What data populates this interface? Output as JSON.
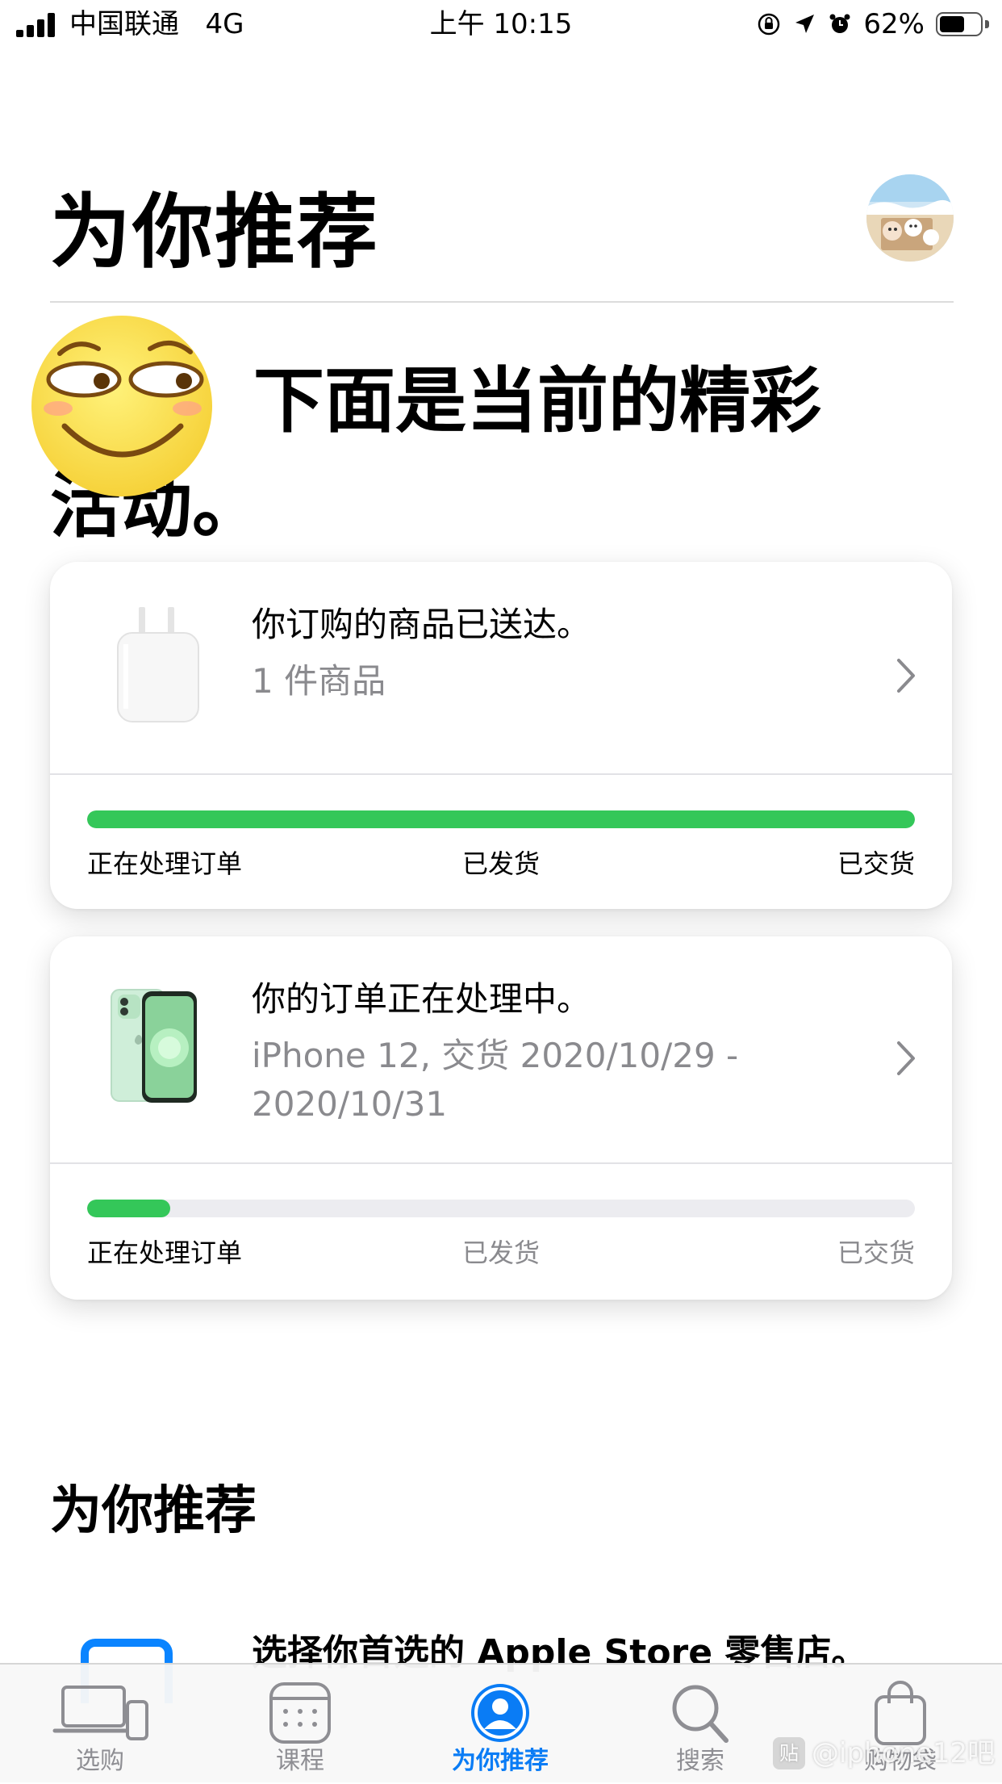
{
  "status_bar": {
    "carrier": "中国联通",
    "network": "4G",
    "time": "上午 10:15",
    "battery_percent": "62%",
    "battery_level": 0.62,
    "icons": [
      "signal-icon",
      "orientation-lock-icon",
      "location-icon",
      "alarm-icon",
      "battery-icon"
    ]
  },
  "header": {
    "title": "为你推荐"
  },
  "headline": {
    "line1": "下面是当前的精彩",
    "line2": "活动。"
  },
  "orders": [
    {
      "title": "你订购的商品已送达。",
      "subtitle": "1 件商品",
      "product_icon": "charger-icon",
      "progress": 1.0,
      "stages": [
        "正在处理订单",
        "已发货",
        "已交货"
      ],
      "stages_done": [
        true,
        true,
        true
      ]
    },
    {
      "title": "你的订单正在处理中。",
      "subtitle": "iPhone 12, 交货 2020/10/29 - 2020/10/31",
      "product_icon": "iphone-icon",
      "progress": 0.1,
      "stages": [
        "正在处理订单",
        "已发货",
        "已交货"
      ],
      "stages_done": [
        true,
        false,
        false
      ]
    }
  ],
  "recommend": {
    "section_title": "为你推荐",
    "item_text": "选择你首选的 Apple Store 零售店。"
  },
  "tabbar": {
    "tabs": [
      {
        "label": "选购",
        "icon": "devices-icon",
        "active": false
      },
      {
        "label": "课程",
        "icon": "calendar-icon",
        "active": false
      },
      {
        "label": "为你推荐",
        "icon": "person-icon",
        "active": true
      },
      {
        "label": "搜索",
        "icon": "search-icon",
        "active": false
      },
      {
        "label": "购物袋",
        "icon": "bag-icon",
        "active": false
      }
    ]
  },
  "watermark": "@iphone12吧",
  "colors": {
    "progress_green": "#34c759",
    "active_blue": "#0a7cf5",
    "muted_gray": "#8a8a8e"
  }
}
